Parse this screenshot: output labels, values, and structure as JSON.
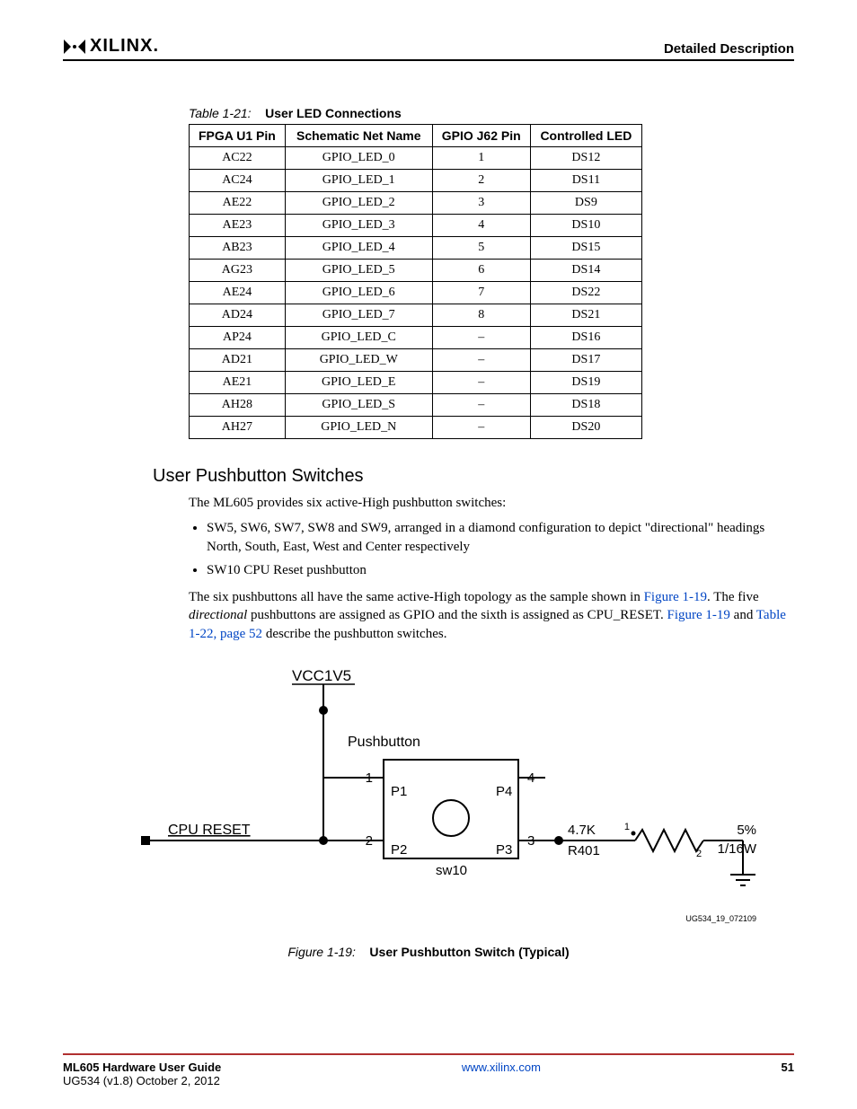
{
  "header": {
    "brand": "XILINX",
    "section": "Detailed Description"
  },
  "table": {
    "caption_label": "Table 1-21:",
    "caption_title": "User LED Connections",
    "headers": [
      "FPGA U1 Pin",
      "Schematic Net Name",
      "GPIO J62 Pin",
      "Controlled LED"
    ],
    "rows": [
      [
        "AC22",
        "GPIO_LED_0",
        "1",
        "DS12"
      ],
      [
        "AC24",
        "GPIO_LED_1",
        "2",
        "DS11"
      ],
      [
        "AE22",
        "GPIO_LED_2",
        "3",
        "DS9"
      ],
      [
        "AE23",
        "GPIO_LED_3",
        "4",
        "DS10"
      ],
      [
        "AB23",
        "GPIO_LED_4",
        "5",
        "DS15"
      ],
      [
        "AG23",
        "GPIO_LED_5",
        "6",
        "DS14"
      ],
      [
        "AE24",
        "GPIO_LED_6",
        "7",
        "DS22"
      ],
      [
        "AD24",
        "GPIO_LED_7",
        "8",
        "DS21"
      ],
      [
        "AP24",
        "GPIO_LED_C",
        "–",
        "DS16"
      ],
      [
        "AD21",
        "GPIO_LED_W",
        "–",
        "DS17"
      ],
      [
        "AE21",
        "GPIO_LED_E",
        "–",
        "DS19"
      ],
      [
        "AH28",
        "GPIO_LED_S",
        "–",
        "DS18"
      ],
      [
        "AH27",
        "GPIO_LED_N",
        "–",
        "DS20"
      ]
    ]
  },
  "section_heading": "User Pushbutton Switches",
  "p1": "The ML605 provides six active-High pushbutton switches:",
  "bullets": [
    "SW5, SW6, SW7, SW8 and SW9, arranged in a diamond configuration to depict \"directional\" headings North, South, East, West and Center respectively",
    "SW10 CPU Reset pushbutton"
  ],
  "p2": {
    "t1": "The six pushbuttons all have the same active-High topology as the sample shown in ",
    "l1": "Figure 1-19",
    "t2": ". The five ",
    "i1": "directional",
    "t3": " pushbuttons are assigned as GPIO and the sixth is assigned as CPU_RESET. ",
    "l2": "Figure 1-19",
    "t4": " and ",
    "l3": "Table 1-22, page 52",
    "t5": " describe the pushbutton switches."
  },
  "figure": {
    "vcc": "VCC1V5",
    "pushbutton": "Pushbutton",
    "p1": "P1",
    "p2": "P2",
    "p3": "P3",
    "p4": "P4",
    "n1": "1",
    "n2": "2",
    "n3": "3",
    "n4": "4",
    "cpu_reset": "CPU RESET",
    "sw": "sw10",
    "rval": "4.7K",
    "rref": "R401",
    "rnode1": "1",
    "rnode2": "2",
    "tol": "5%",
    "pwr": "1/16W",
    "code": "UG534_19_072109",
    "caption_label": "Figure 1-19:",
    "caption_title": "User Pushbutton Switch (Typical)"
  },
  "footer": {
    "title": "ML605 Hardware User Guide",
    "sub": "UG534 (v1.8) October 2, 2012",
    "url": "www.xilinx.com",
    "page": "51"
  }
}
